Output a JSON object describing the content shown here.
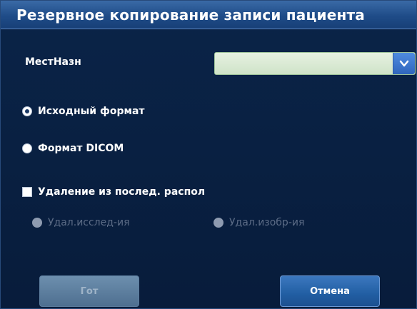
{
  "dialog": {
    "title": "Резервное копирование записи пациента",
    "destination": {
      "label": "МестНазн",
      "value": ""
    },
    "format_options": [
      {
        "label": "Исходный формат",
        "checked": true
      },
      {
        "label": "Формат DICOM",
        "checked": false
      }
    ],
    "delete_after_backup": {
      "label": "Удаление из послед. распол",
      "checked": false
    },
    "delete_options": [
      {
        "label": "Удал.исслед-ия",
        "enabled": false
      },
      {
        "label": "Удал.изобр-ия",
        "enabled": false
      }
    ],
    "buttons": {
      "ok": "Гот",
      "cancel": "Отмена"
    }
  },
  "colors": {
    "background": "#0a2448",
    "titlebar": "#1f4c88",
    "select_bg": "#d9eacf",
    "button_active": "#215ea3",
    "button_disabled": "#4e6f90"
  }
}
